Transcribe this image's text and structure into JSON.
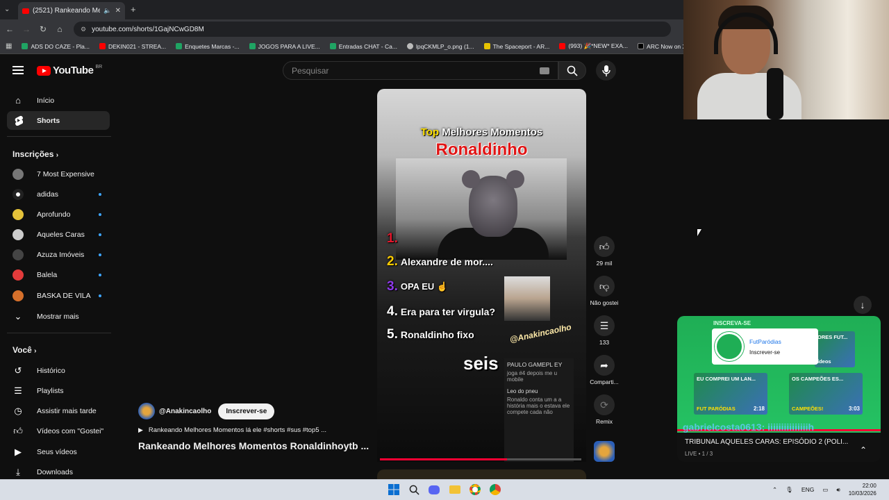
{
  "browser": {
    "tab_title": "(2521) Rankeando Melhore",
    "url": "youtube.com/shorts/1GajNCwGD8M",
    "bookmarks": [
      {
        "label": "ADS DO CAZE - Pla...",
        "color": "#1fa463"
      },
      {
        "label": "DEKIN021 - STREA...",
        "color": "#ff0000"
      },
      {
        "label": "Enquetes Marcas -...",
        "color": "#1fa463"
      },
      {
        "label": "JOGOS PARA A LIVE...",
        "color": "#1fa463"
      },
      {
        "label": "Entradas CHAT - Ca...",
        "color": "#1fa463"
      },
      {
        "label": "lpqCKMLP_o.png (1...",
        "color": "#bbbbbb"
      },
      {
        "label": "The Spaceport - AR...",
        "color": "#e6c200"
      },
      {
        "label": "(993) 🎉*NEW* EXA...",
        "color": "#ff0000"
      },
      {
        "label": "ARC Now on X: \"Co...",
        "color": "#000000"
      }
    ]
  },
  "youtube": {
    "logo_text": "YouTube",
    "region": "BR",
    "search_placeholder": "Pesquisar"
  },
  "sidebar": {
    "main": [
      {
        "label": "Início",
        "icon": "home-icon"
      },
      {
        "label": "Shorts",
        "icon": "shorts-icon",
        "active": true
      }
    ],
    "subscriptions_title": "Inscrições",
    "subscriptions": [
      {
        "label": "7 Most Expensive",
        "color": "#777777",
        "dot": false
      },
      {
        "label": "adidas",
        "color": "#222222",
        "dot": true
      },
      {
        "label": "Aprofundo",
        "color": "#e4c23a",
        "dot": true
      },
      {
        "label": "Aqueles Caras",
        "color": "#cccccc",
        "dot": true
      },
      {
        "label": "Azuza Imóveis",
        "color": "#444444",
        "dot": true
      },
      {
        "label": "Balela",
        "color": "#e23b3b",
        "dot": true
      },
      {
        "label": "BASKA DE VILA",
        "color": "#d6702b",
        "dot": true
      }
    ],
    "show_more": "Mostrar mais",
    "you_title": "Você",
    "you": [
      {
        "label": "Histórico",
        "icon": "history-icon"
      },
      {
        "label": "Playlists",
        "icon": "playlist-icon"
      },
      {
        "label": "Assistir mais tarde",
        "icon": "clock-icon"
      },
      {
        "label": "Vídeos com \"Gostei\"",
        "icon": "thumbs-up-icon"
      },
      {
        "label": "Seus vídeos",
        "icon": "video-icon"
      },
      {
        "label": "Downloads",
        "icon": "download-icon"
      }
    ]
  },
  "short": {
    "overlay_top": "Top",
    "overlay_title": "Melhores Momentos",
    "overlay_name": "Ronaldinho",
    "ranks": [
      {
        "n": "1.",
        "text": "",
        "color": "#e3182d"
      },
      {
        "n": "2.",
        "text": "Alexandre de mor....",
        "color": "#ffcc00"
      },
      {
        "n": "3.",
        "text": "OPA EU ☝",
        "color": "#8d39e8"
      },
      {
        "n": "4.",
        "text": "Era para ter virgula?",
        "color": "#ffffff"
      },
      {
        "n": "5.",
        "text": "Ronaldinho fixo",
        "color": "#ffffff"
      }
    ],
    "watermark": "@Anakincaolho",
    "caption": "seis",
    "side_text_name": "PAULO GAMEPL EY",
    "side_text_1": "joga #4 depois me u mobile",
    "side_text_2": "Leo do pneu",
    "side_text_3": "Ronaldo conta um a a história mais o estava ele compete cada não",
    "progress": 0.63
  },
  "actions": {
    "likes": "29 mil",
    "dislike": "Não gostei",
    "comments": "133",
    "share": "Comparti...",
    "remix": "Remix"
  },
  "channel": {
    "handle": "@Anakincaolho",
    "subscribe": "Inscrever-se",
    "description": "Rankeando Melhores Momentos lá ele #shorts #sus #top5 ...",
    "title": "Rankeando Melhores Momentos Ronaldinhoytb ..."
  },
  "live_widget": {
    "header_ghost": "INSCREVA-SE",
    "card_name": "FutParódias",
    "card_subscribe": "Inscrever-se",
    "thumbs": [
      {
        "label": "EU COMPREI UM LAN...",
        "sub": "FUT PARÓDIAS",
        "duration": "2:18"
      },
      {
        "label": "OS CAMPEÕES ES...",
        "sub": "CAMPEÕES!",
        "duration": "3:03"
      },
      {
        "label": "ORES FUT...",
        "sub": "ídeos",
        "duration": ""
      }
    ],
    "chat_ghost": "gabrielcosta0613: iiiiiiiiiiiiiiih",
    "title": "TRIBUNAL AQUELES CARAS: EPISÓDIO 2 (POLI...",
    "live_count": "LIVE • 1 / 3"
  },
  "taskbar": {
    "lang": "ENG",
    "time": "22:00",
    "date": "10/03/2026"
  }
}
